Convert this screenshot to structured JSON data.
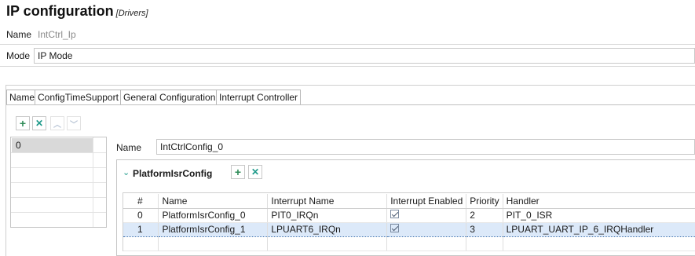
{
  "header": {
    "title": "IP configuration",
    "subtitle": "[Drivers]"
  },
  "name_row": {
    "label": "Name",
    "value": "IntCtrl_Ip"
  },
  "mode_row": {
    "label": "Mode",
    "value": "IP Mode"
  },
  "tabs": [
    {
      "label": "Name"
    },
    {
      "label": "ConfigTimeSupport"
    },
    {
      "label": "General Configuration"
    },
    {
      "label": "Interrupt Controller",
      "active": true
    }
  ],
  "toolbar": {
    "add_icon": "plus-icon",
    "remove_icon": "close-icon",
    "up_icon": "chevron-up-icon",
    "down_icon": "chevron-down-icon"
  },
  "config_list": {
    "items": [
      "0"
    ]
  },
  "detail": {
    "name_label": "Name",
    "name_value": "IntCtrlConfig_0"
  },
  "section": {
    "title": "PlatformIsrConfig",
    "columns": [
      "#",
      "Name",
      "Interrupt Name",
      "Interrupt Enabled",
      "Priority",
      "Handler"
    ],
    "rows": [
      {
        "index": "0",
        "name": "PlatformIsrConfig_0",
        "interrupt_name": "PIT0_IRQn",
        "enabled": true,
        "priority": "2",
        "handler": "PIT_0_ISR"
      },
      {
        "index": "1",
        "name": "PlatformIsrConfig_1",
        "interrupt_name": "LPUART6_IRQn",
        "enabled": true,
        "priority": "3",
        "handler": "LPUART_UART_IP_6_IRQHandler"
      }
    ]
  },
  "colors": {
    "add": "#2e8b57",
    "remove": "#1f9a8a",
    "selection": "#dce9f9"
  }
}
